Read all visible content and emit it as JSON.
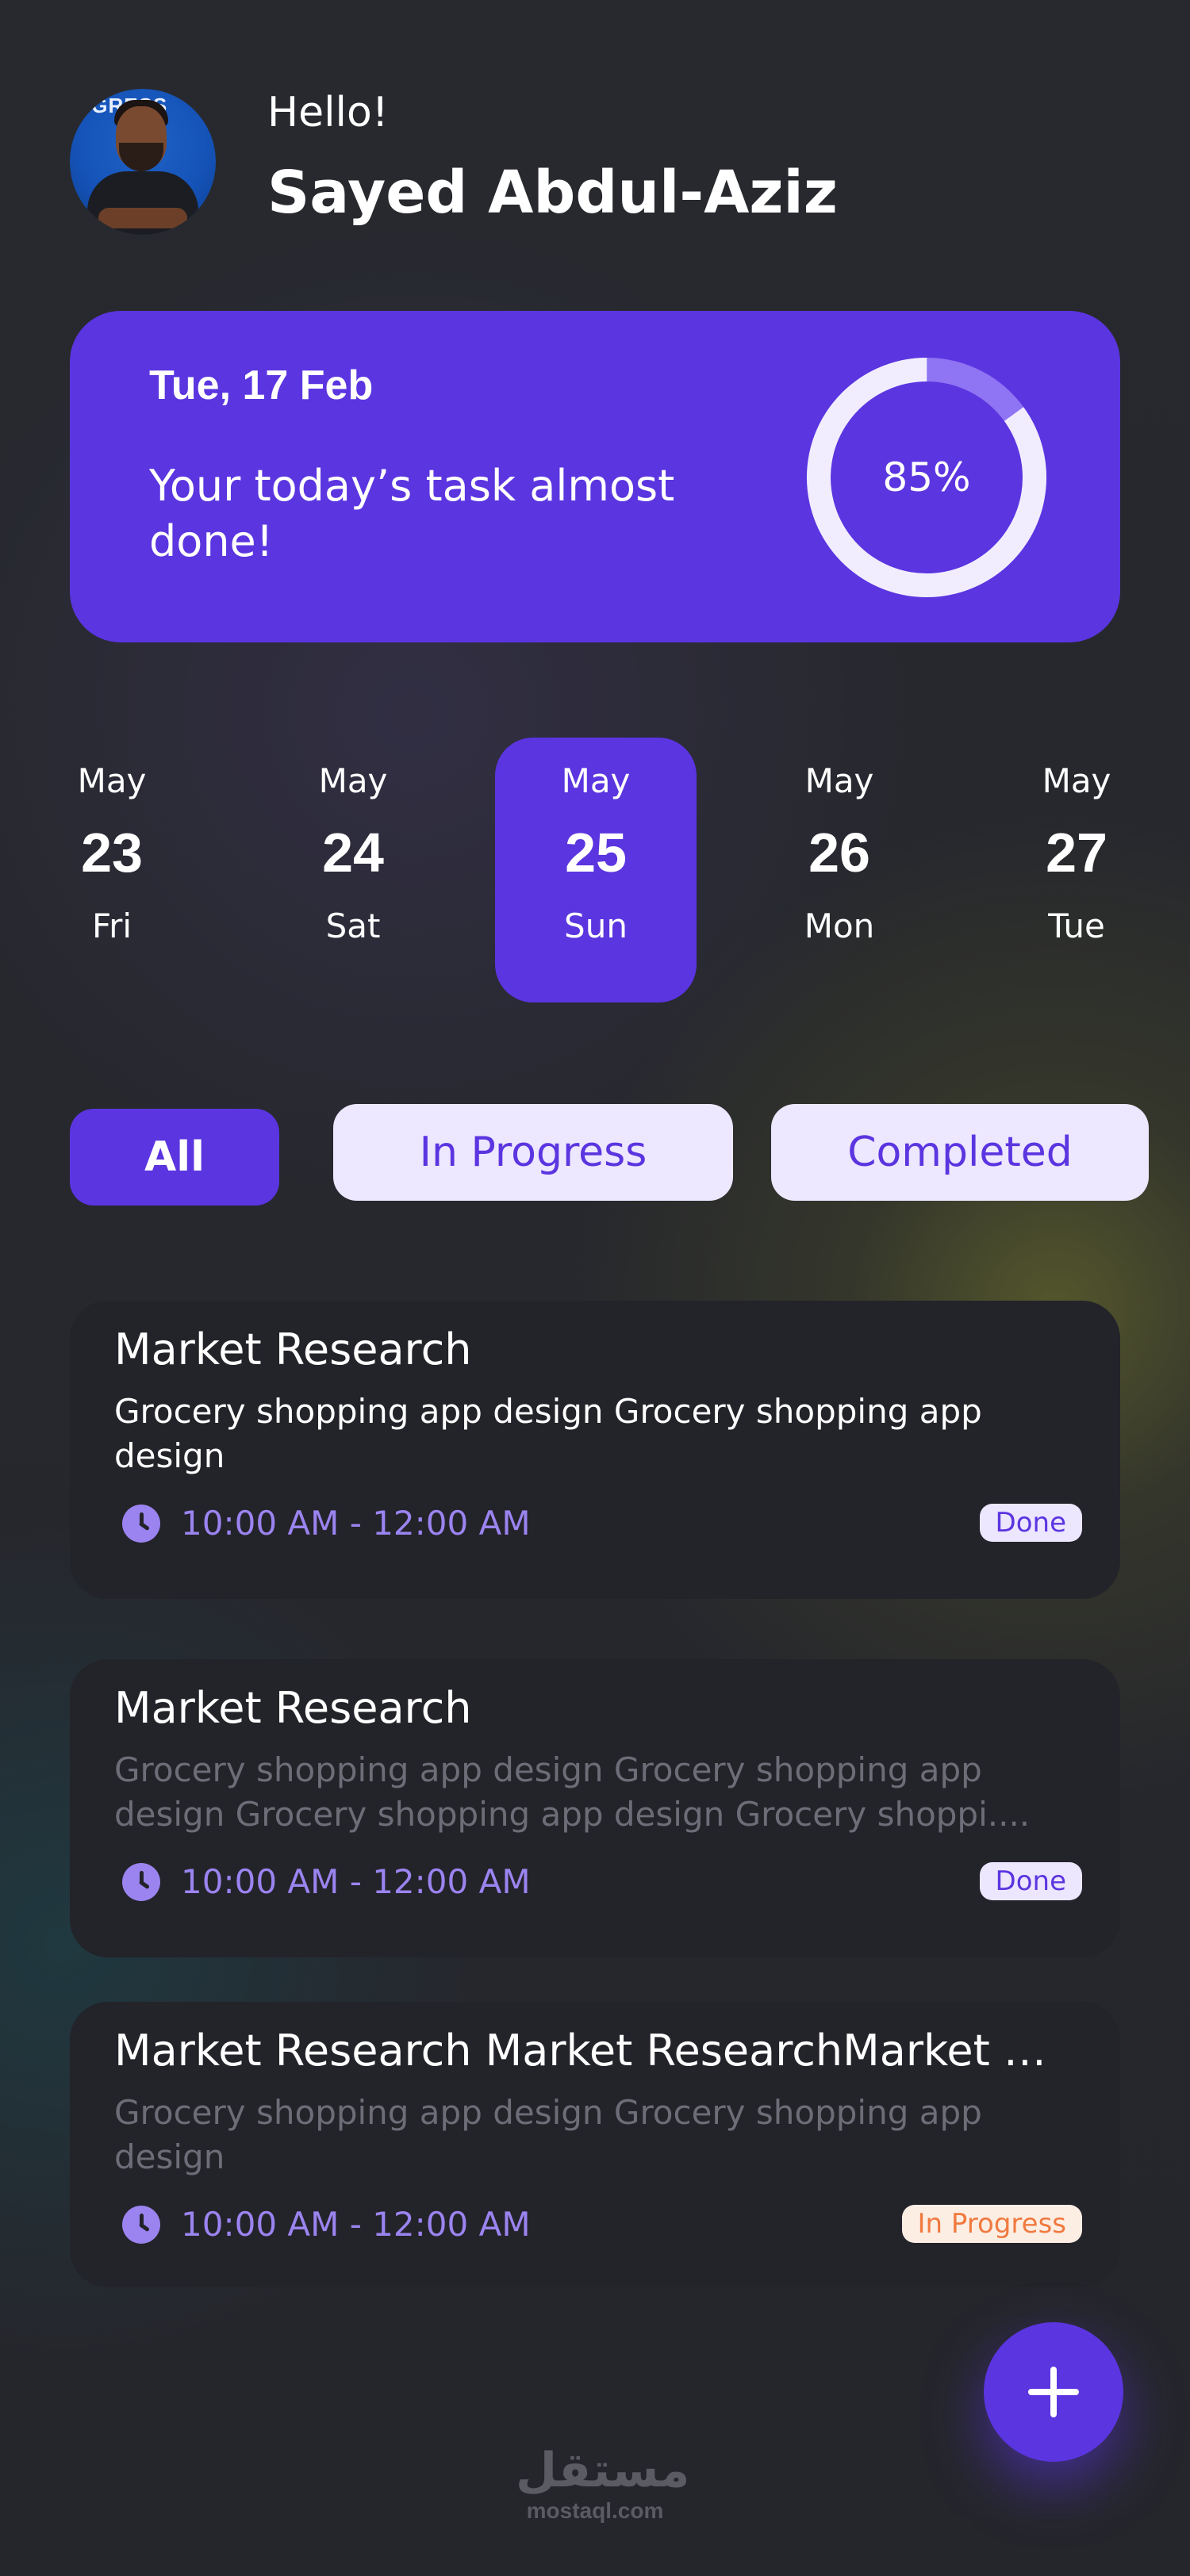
{
  "header": {
    "greeting": "Hello!",
    "user_name": "Sayed Abdul-Aziz",
    "avatar_sign_text": "OGRESS"
  },
  "progress_card": {
    "date": "Tue, 17 Feb",
    "message": "Your today’s task almost done!",
    "percent_label": "85%",
    "percent_value": 0.85
  },
  "calendar": {
    "days": [
      {
        "month": "May",
        "day": "23",
        "weekday": "Fri",
        "selected": false
      },
      {
        "month": "May",
        "day": "24",
        "weekday": "Sat",
        "selected": false
      },
      {
        "month": "May",
        "day": "25",
        "weekday": "Sun",
        "selected": true
      },
      {
        "month": "May",
        "day": "26",
        "weekday": "Mon",
        "selected": false
      },
      {
        "month": "May",
        "day": "27",
        "weekday": "Tue",
        "selected": false
      }
    ]
  },
  "filters": {
    "all": "All",
    "in_progress": "In Progress",
    "completed": "Completed",
    "selected": "All"
  },
  "tasks": [
    {
      "title": "Market Research",
      "description": "Grocery shopping app design Grocery shopping app design",
      "time": "10:00 AM - 12:00 AM",
      "status": "Done"
    },
    {
      "title": "Market Research",
      "description": "Grocery shopping app design Grocery shopping app design Grocery shopping app design Grocery shoppi....",
      "time": "10:00 AM - 12:00 AM",
      "status": "Done"
    },
    {
      "title": "Market Research Market ResearchMarket Research",
      "description": "Grocery shopping app design Grocery shopping app design",
      "time": "10:00 AM - 12:00 AM",
      "status": "In Progress"
    }
  ],
  "fab": {
    "icon": "plus-icon"
  },
  "watermark": {
    "arabic": "مستقل",
    "latin": "mostaql.com"
  },
  "colors": {
    "background": "#24252c",
    "accent": "#5b35e0",
    "accent_light": "#ede7ff",
    "time_text": "#9b84f0",
    "card_bg": "#23232a",
    "in_progress_bg": "#fdeee4",
    "in_progress_text": "#f07a3f"
  }
}
